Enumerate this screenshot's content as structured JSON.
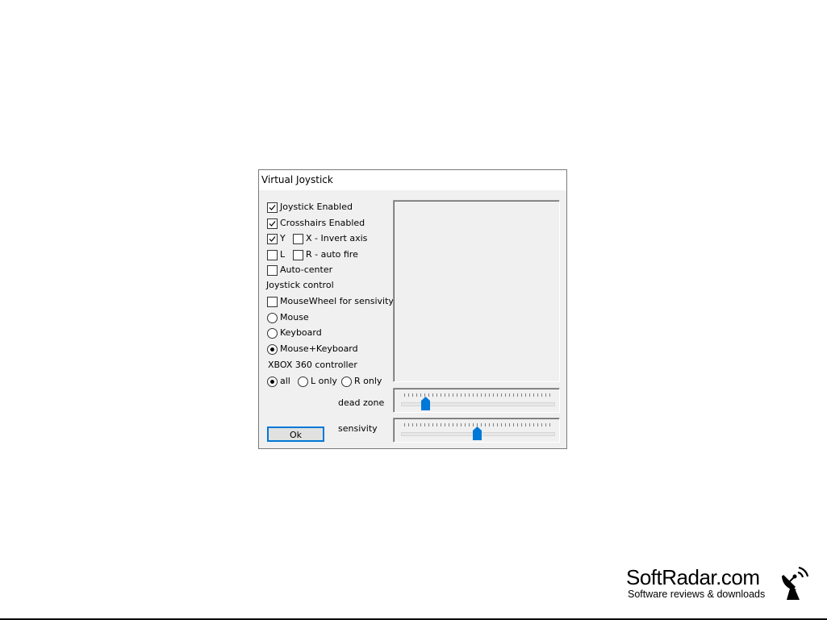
{
  "window": {
    "title": "Virtual Joystick"
  },
  "options": {
    "joystick_enabled": {
      "label": "Joystick Enabled",
      "checked": true
    },
    "crosshairs_enabled": {
      "label": "Crosshairs Enabled",
      "checked": true
    },
    "y_axis": {
      "label": "Y",
      "checked": true
    },
    "x_invert": {
      "label": "X - Invert axis",
      "checked": false
    },
    "l_fire": {
      "label": "L",
      "checked": false
    },
    "r_auto_fire": {
      "label": "R - auto fire",
      "checked": false
    },
    "auto_center": {
      "label": "Auto-center",
      "checked": false
    }
  },
  "joystick_control": {
    "heading": "Joystick control",
    "mousewheel": {
      "label": "MouseWheel for sensivity",
      "checked": false
    },
    "modes": [
      {
        "label": "Mouse",
        "selected": false
      },
      {
        "label": "Keyboard",
        "selected": false
      },
      {
        "label": "Mouse+Keyboard",
        "selected": true
      }
    ]
  },
  "xbox": {
    "heading": "XBOX 360 controller",
    "modes": [
      {
        "label": "all",
        "selected": true
      },
      {
        "label": "L only",
        "selected": false
      },
      {
        "label": "R only",
        "selected": false
      }
    ]
  },
  "sliders": {
    "dead_zone": {
      "label": "dead zone",
      "value": 0.14
    },
    "sensivity": {
      "label": "sensivity",
      "value": 0.5
    }
  },
  "buttons": {
    "ok_label": "Ok"
  },
  "colors": {
    "accent": "#0078d7"
  },
  "watermark": {
    "title": "SoftRadar.com",
    "subtitle": "Software reviews & downloads"
  }
}
